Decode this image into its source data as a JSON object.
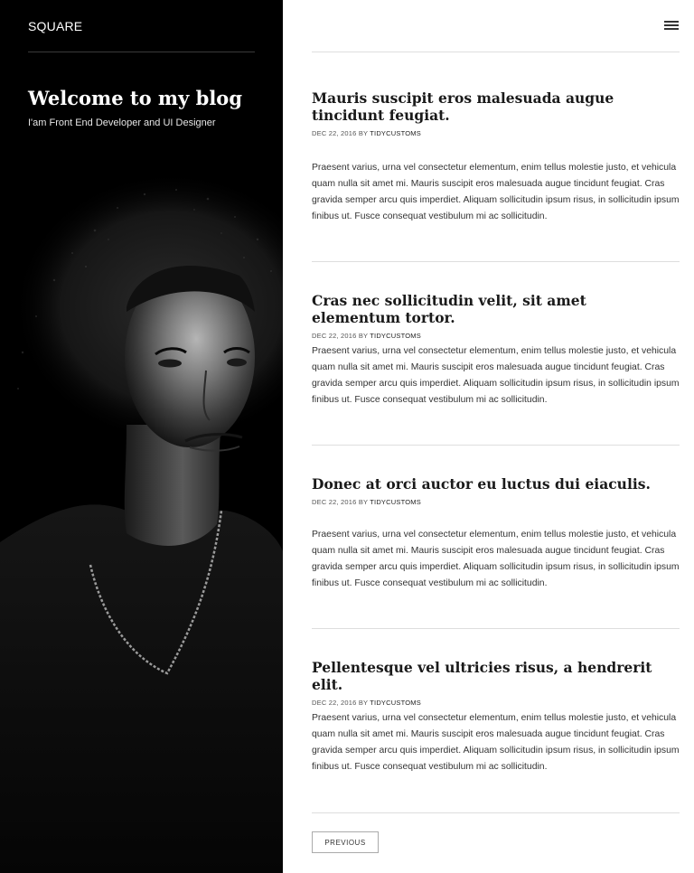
{
  "site": {
    "name": "SQUARE",
    "blog_title": "Welcome to my blog",
    "tagline": "I'am Front End Developer and UI Designer"
  },
  "header": {
    "menu_icon": "hamburger-menu-icon"
  },
  "posts": [
    {
      "title": "Mauris suscipit eros malesuada augue tincidunt feugiat.",
      "date": "DEC 22, 2016",
      "by": "BY",
      "author": "TIDYCUSTOMS",
      "excerpt": "Praesent varius, urna vel consectetur elementum, enim tellus molestie justo, et vehicula quam nulla sit amet mi. Mauris suscipit eros malesuada augue tincidunt feugiat. Cras gravida semper arcu quis imperdiet. Aliquam sollicitudin ipsum risus, in sollicitudin ipsum finibus ut. Fusce consequat vestibulum mi ac sollicitudin."
    },
    {
      "title": "Cras nec sollicitudin velit, sit amet elementum tortor.",
      "date": "DEC 22, 2016",
      "by": "BY",
      "author": "TIDYCUSTOMS",
      "excerpt": "Praesent varius, urna vel consectetur elementum, enim tellus molestie justo, et vehicula quam nulla sit amet mi. Mauris suscipit eros malesuada augue tincidunt feugiat. Cras gravida semper arcu quis imperdiet. Aliquam sollicitudin ipsum risus, in sollicitudin ipsum finibus ut. Fusce consequat vestibulum mi ac sollicitudin."
    },
    {
      "title": "Donec at orci auctor eu luctus dui eiaculis.",
      "date": "DEC 22, 2016",
      "by": "BY",
      "author": "TIDYCUSTOMS",
      "excerpt": "Praesent varius, urna vel consectetur elementum, enim tellus molestie justo, et vehicula quam nulla sit amet mi. Mauris suscipit eros malesuada augue tincidunt feugiat. Cras gravida semper arcu quis imperdiet. Aliquam sollicitudin ipsum risus, in sollicitudin ipsum finibus ut. Fusce consequat vestibulum mi ac sollicitudin."
    },
    {
      "title": "Pellentesque vel ultricies risus, a hendrerit elit.",
      "date": "DEC 22, 2016",
      "by": "BY",
      "author": "TIDYCUSTOMS",
      "excerpt": "Praesent varius, urna vel consectetur elementum, enim tellus molestie justo, et vehicula quam nulla sit amet mi. Mauris suscipit eros malesuada augue tincidunt feugiat. Cras gravida semper arcu quis imperdiet. Aliquam sollicitudin ipsum risus, in sollicitudin ipsum finibus ut. Fusce consequat vestibulum mi ac sollicitudin."
    }
  ],
  "pagination": {
    "previous_label": "PREVIOUS"
  },
  "colors": {
    "sidebar_bg": "#000000",
    "page_bg": "#ffffff",
    "text": "#1a1a1a",
    "rule": "#dedede"
  }
}
